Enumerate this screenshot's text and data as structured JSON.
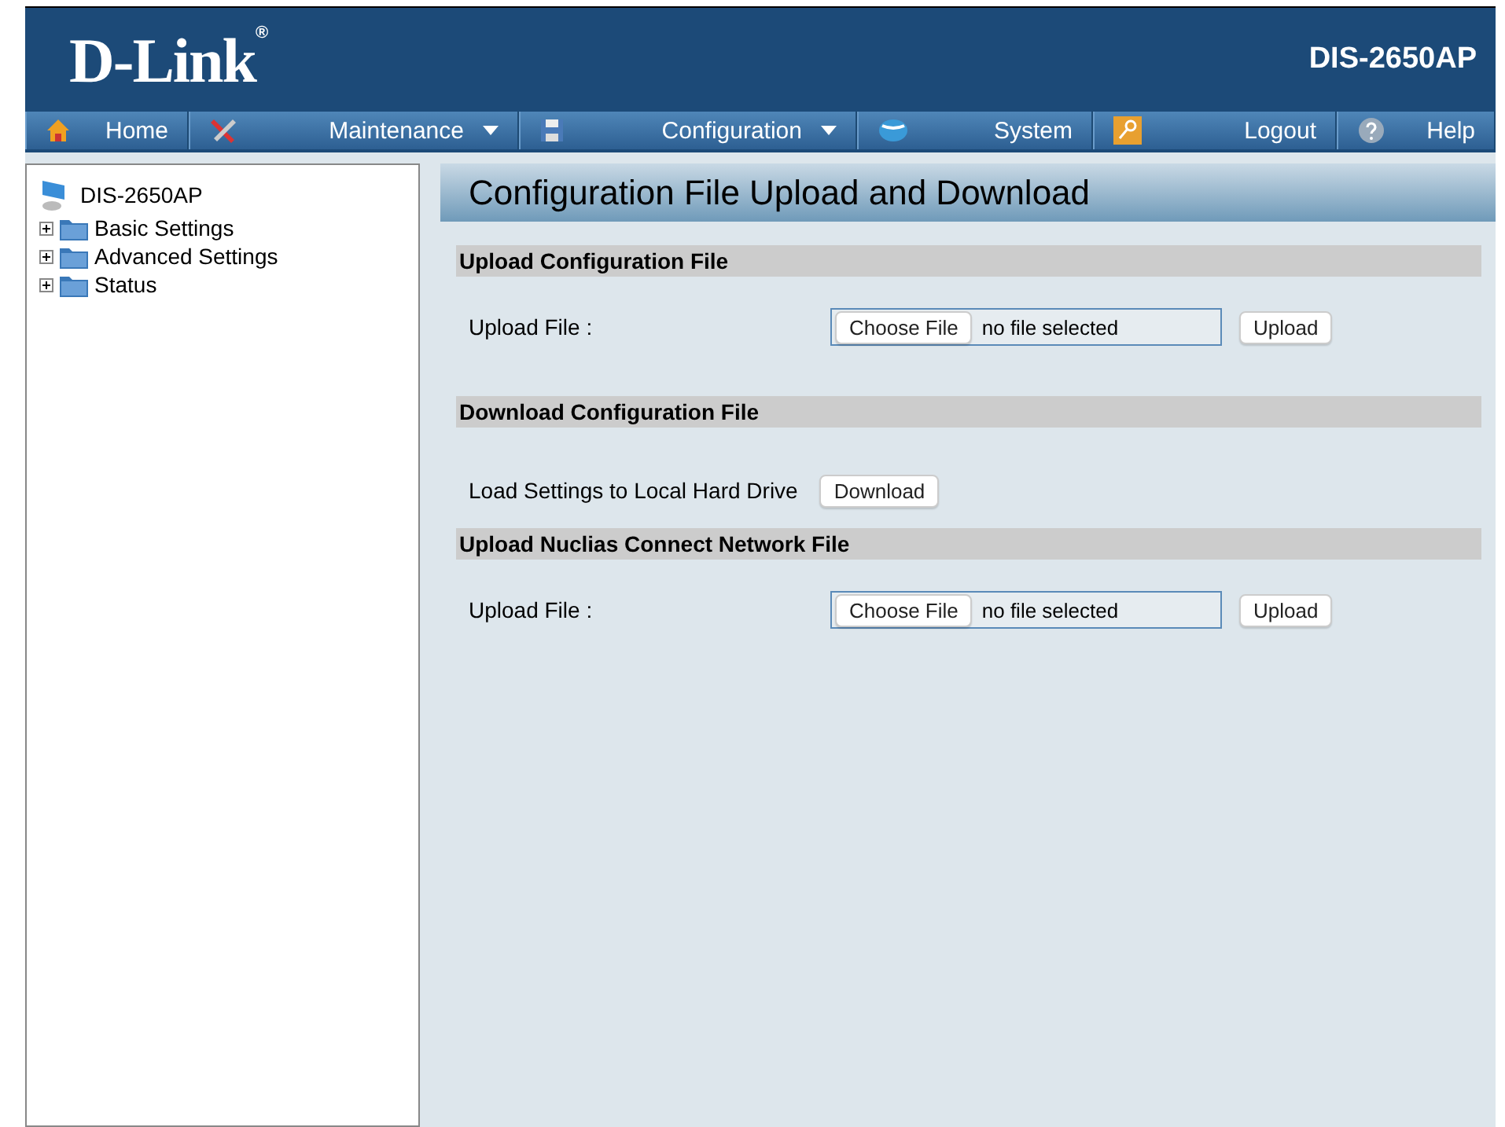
{
  "header": {
    "logo": "D-Link$^{®}$",
    "model": "DIS-2650AP"
  },
  "nav": [
    {
      "label": "Home",
      "dropdown": false
    },
    {
      "label": "Maintenance",
      "dropdown": true
    },
    {
      "label": "Configuration",
      "dropdown": true
    },
    {
      "label": "System",
      "dropdown": false
    },
    {
      "label": "Logout",
      "dropdown": false
    },
    {
      "label": "Help",
      "dropdown": false
    }
  ],
  "tree": {
    "root": "DIS-2650AP",
    "children": [
      {
        "label": "Basic Settings",
        "expanded": false
      },
      {
        "label": "Advanced Settings",
        "expanded": false
      },
      {
        "label": "Status",
        "expanded": false
      }
    ]
  },
  "page_title": "Configuration File Upload and Download",
  "sections": [
    {
      "title": "Upload Configuration File",
      "row": {
        "kind": "file",
        "label": "Upload File :",
        "choose_label": "Choose File",
        "file_status": "no file selected",
        "button": "Upload"
      }
    },
    {
      "title": "Download Configuration File",
      "row": {
        "kind": "action",
        "label": "Load Settings to Local Hard Drive",
        "button": "Download"
      }
    },
    {
      "title": "Upload Nuclias Connect Network File",
      "row": {
        "kind": "file",
        "label": "Upload File :",
        "choose_label": "Choose File",
        "file_status": "no file selected",
        "button": "Upload"
      }
    }
  ]
}
